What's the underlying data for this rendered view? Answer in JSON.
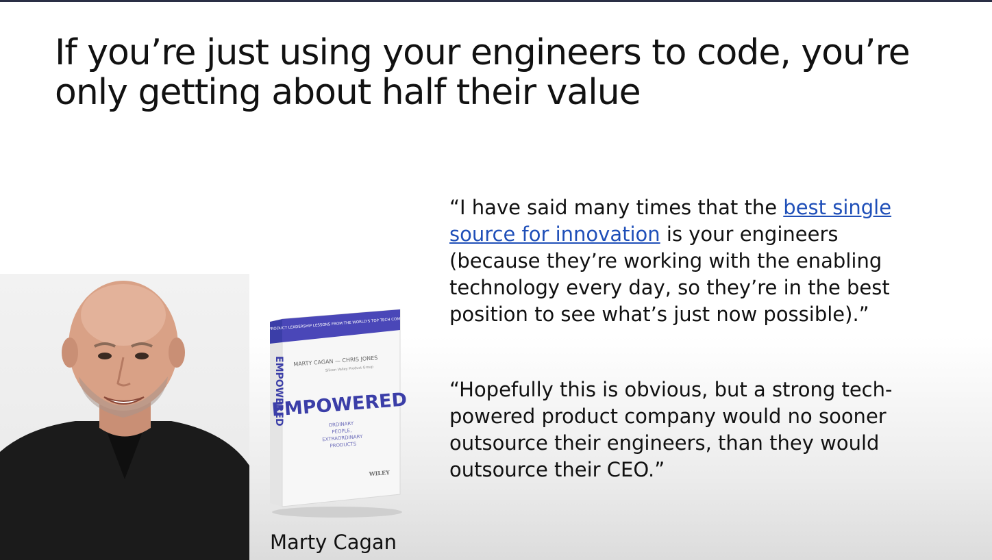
{
  "slide": {
    "title": "If you’re just using your engineers to code, you’re only getting about half their value",
    "quote1": {
      "open": "“I have said many times that the ",
      "link": "best single source for innovation",
      "rest": " is your engineers (because  they’re working with the enabling technology every day, so they’re in the best position to see what’s just now possible).”"
    },
    "quote2": "“Hopefully this is obvious, but a strong tech-powered product company would no sooner outsource their engineers, than they would outsource their CEO.”",
    "caption": "Marty Cagan"
  },
  "book": {
    "banner": "PRODUCT LEADERSHIP LESSONS FROM THE WORLD'S TOP TECH COMPANIES",
    "authors": "MARTY CAGAN — CHRIS JONES",
    "author_sub": "Silicon Valley Product Group",
    "title": "EMPOWERED",
    "subtitle_line1": "ORDINARY",
    "subtitle_line2": "PEOPLE,",
    "subtitle_line3": "EXTRAORDINARY",
    "subtitle_line4": "PRODUCTS",
    "publisher": "WILEY",
    "spine_title": "EMPOWERED"
  },
  "colors": {
    "accent": "#3b3ea8",
    "link": "#1f4fb8",
    "top_bar": "#2a2f45"
  }
}
